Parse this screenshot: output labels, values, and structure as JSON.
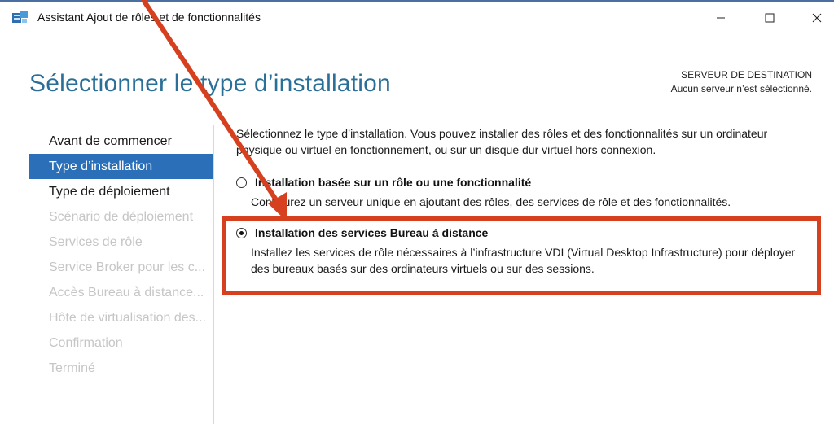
{
  "window": {
    "title": "Assistant Ajout de rôles et de fonctionnalités",
    "controls": {
      "minimize": "–",
      "maximize": "☐",
      "close": "✕"
    }
  },
  "header": {
    "title": "Sélectionner le type d’installation",
    "destination_label": "SERVEUR DE DESTINATION",
    "destination_value": "Aucun serveur n’est sélectionné."
  },
  "nav": {
    "items": [
      {
        "label": "Avant de commencer",
        "state": "normal"
      },
      {
        "label": "Type d’installation",
        "state": "active"
      },
      {
        "label": "Type de déploiement",
        "state": "normal"
      },
      {
        "label": "Scénario de déploiement",
        "state": "disabled"
      },
      {
        "label": "Services de rôle",
        "state": "disabled"
      },
      {
        "label": "Service Broker pour les c...",
        "state": "disabled"
      },
      {
        "label": "Accès Bureau à distance...",
        "state": "disabled"
      },
      {
        "label": "Hôte de virtualisation des...",
        "state": "disabled"
      },
      {
        "label": "Confirmation",
        "state": "disabled"
      },
      {
        "label": "Terminé",
        "state": "disabled"
      }
    ]
  },
  "content": {
    "intro": "Sélectionnez le type d’installation. Vous pouvez installer des rôles et des fonctionnalités sur un ordinateur physique ou virtuel en fonctionnement, ou sur un disque dur virtuel hors connexion.",
    "options": [
      {
        "title": "Installation basée sur un rôle ou une fonctionnalité",
        "description": "Configurez un serveur unique en ajoutant des rôles, des services de rôle et des fonctionnalités.",
        "selected": false
      },
      {
        "title": "Installation des services Bureau à distance",
        "description": "Installez les services de rôle nécessaires à l’infrastructure VDI (Virtual Desktop Infrastructure) pour déployer des bureaux basés sur des ordinateurs virtuels ou sur des sessions.",
        "selected": true
      }
    ]
  },
  "annotation": {
    "color": "#d6401e"
  },
  "colors": {
    "accent": "#2a6fb7",
    "title": "#2a6f97",
    "disabled": "#c6c6c6"
  },
  "icons": {
    "app": "server-manager-icon",
    "radio_on": "radio-checked-icon",
    "radio_off": "radio-unchecked-icon"
  }
}
